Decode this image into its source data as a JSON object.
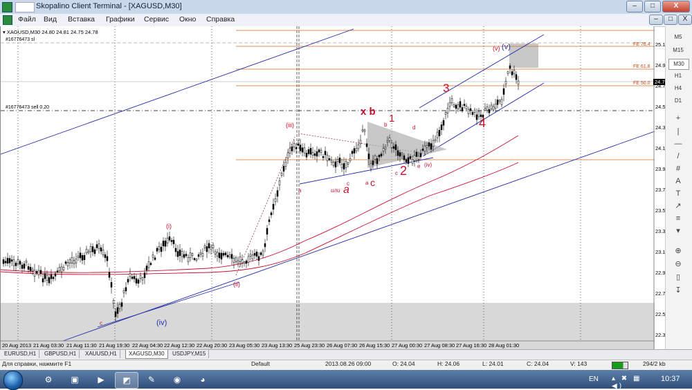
{
  "window": {
    "title": "Skopalino Client Terminal - [XAGUSD,M30]",
    "minimize": "–",
    "maximize": "□",
    "close": "X"
  },
  "menu": [
    "Файл",
    "Вид",
    "Вставка",
    "Графики",
    "Сервис",
    "Окно",
    "Справка"
  ],
  "chart": {
    "header": "XAGUSD,M30  24.80 24.81 24.75 24.78",
    "order_sl": "#16776473 sl",
    "order_sell": "#16776473 sell 0.20",
    "current_price": "24.78",
    "price_labels": [
      "25.15",
      "24.95",
      "24.75",
      "24.55",
      "24.35",
      "24.15",
      "23.95",
      "23.75",
      "23.55",
      "23.35",
      "23.15",
      "22.95",
      "22.75",
      "22.55",
      "22.35"
    ],
    "time_labels": [
      "20 Aug 2013",
      "21 Aug 03:30",
      "21 Aug 11:30",
      "21 Aug 19:30",
      "22 Aug 04:30",
      "22 Aug 12:30",
      "22 Aug 20:30",
      "23 Aug 05:30",
      "23 Aug 13:30",
      "25 Aug 23:30",
      "26 Aug 07:30",
      "26 Aug 15:30",
      "27 Aug 00:30",
      "27 Aug 08:30",
      "27 Aug 16:30",
      "28 Aug 01:30"
    ],
    "fe_labels": [
      "FE 76.4",
      "FE 61.8",
      "FE 50.0"
    ],
    "annotations": {
      "i": "(i)",
      "ii": "(ii)",
      "iii": "(iii)",
      "iv_blue": "(iv)",
      "iv_red": "(iv)",
      "v_red": "(v)",
      "v_blue": "(v)",
      "a1": "a",
      "a2": "a",
      "b1": "b",
      "c1": "c",
      "c2": "c",
      "d1": "d",
      "e1": "e",
      "c_low": "c",
      "ili": "или",
      "hand_a": "a",
      "hand_b": "x b",
      "hand_1": "1",
      "hand_2": "2",
      "hand_3": "3",
      "hand_4": "4",
      "hand_c": "c"
    }
  },
  "timeframes": [
    "M5",
    "M15",
    "M30",
    "H1",
    "H4",
    "D1"
  ],
  "tools": [
    "+",
    "|",
    "—",
    "/",
    "#",
    "A",
    "T",
    "↗",
    "≡",
    "▾",
    "⊕",
    "⊖",
    "▯",
    "↧"
  ],
  "tabs": [
    "EURUSD,H1",
    "GBPUSD,H1",
    "XAUUSD,H1",
    "XAGUSD,M30",
    "USDJPY,M15"
  ],
  "active_tab": "XAGUSD,M30",
  "status": {
    "help": "Для справки, нажмите F1",
    "profile": "Default",
    "time": "2013.08.26 09:00",
    "open": "O: 24.04",
    "high": "H: 24.06",
    "low": "L: 24.01",
    "close": "C: 24.04",
    "volume": "V: 143",
    "traffic": "294/2 kb"
  },
  "taskbar": {
    "lang": "EN",
    "clock": "10:37"
  },
  "colors": {
    "titlebar": "#c9d8ea",
    "grid": "#000000",
    "candle_up": "#000000",
    "candle_down": "#000000",
    "ma_red": "#c8102e",
    "trend_blue": "#2530a8",
    "fib_line": "#d2691e"
  }
}
